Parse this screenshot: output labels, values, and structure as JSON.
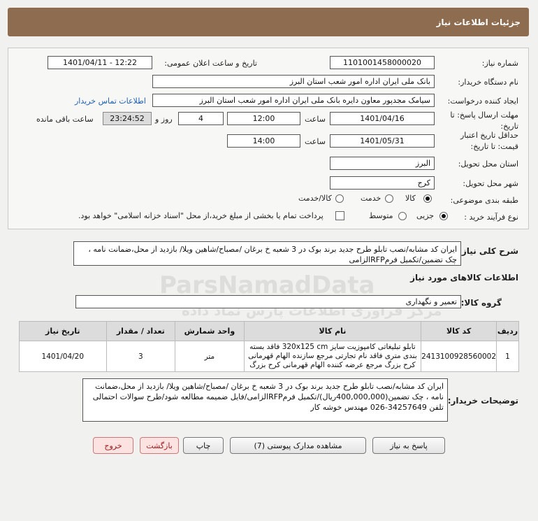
{
  "header": {
    "title": "جزئیات اطلاعات نیاز"
  },
  "fields": {
    "need_number_label": "شماره نیاز:",
    "need_number": "1101001458000020",
    "announce_label": "تاریخ و ساعت اعلان عمومی:",
    "announce_value": "1401/04/11 - 12:22",
    "buyer_org_label": "نام دستگاه خریدار:",
    "buyer_org": "بانک ملی ایران اداره امور شعب استان البرز",
    "creator_label": "ایجاد کننده درخواست:",
    "creator": "سیامک مجدپور معاون دایره  بانک ملی ایران اداره امور شعب استان البرز",
    "contact_link": "اطلاعات تماس خریدار",
    "reply_deadline_label": "مهلت ارسال پاسخ: تا تاریخ:",
    "reply_date": "1401/04/16",
    "time_label": "ساعت",
    "reply_time": "12:00",
    "days_value": "4",
    "days_label": "روز و",
    "remaining_time": "23:24:52",
    "remaining_label": "ساعت باقی مانده",
    "validity_label": "حداقل تاریخ اعتبار قیمت: تا تاریخ:",
    "validity_date": "1401/05/31",
    "validity_time_label": "ساعت",
    "validity_time": "14:00",
    "province_label": "استان محل تحویل:",
    "province": "البرز",
    "city_label": "شهر محل تحویل:",
    "city": "کرج",
    "category_label": "طبقه بندی موضوعی:",
    "category_options": [
      "کالا",
      "خدمت",
      "کالا/خدمت"
    ],
    "process_label": "نوع فرآیند خرید :",
    "process_options": [
      "جزیی",
      "متوسط"
    ],
    "payment_note": "پرداخت تمام یا بخشی از مبلغ خرید،از محل \"اسناد خزانه اسلامی\" خواهد بود."
  },
  "summary": {
    "label": "شرح کلی نیاز:",
    "text": "ایران کد مشابه/نصب تابلو طرح جدید برند بوک در 3 شعبه خ برغان /مصباح/شاهین ویلا/ بازدید از محل،ضمانت نامه ، چک تضمین/تکمیل فرمRFPالزامی"
  },
  "goods": {
    "section_title": "اطلاعات کالاهای مورد نیاز",
    "group_label": "گروه کالا:",
    "group_value": "تعمیر و نگهداری",
    "columns": [
      "ردیف",
      "کد کالا",
      "نام کالا",
      "واحد شمارش",
      "تعداد / مقدار",
      "تاریخ نیاز"
    ],
    "rows": [
      {
        "row": "1",
        "code": "2413100928560002",
        "name": "تابلو تبلیغاتی کامپوزیت سایز 320x125 cm فاقد بسته بندی متری فاقد نام تجارتی مرجع سازنده الهام قهرمانی کرح بزرگ مرجع عرضه کننده الهام قهرمانی کرح بزرگ",
        "unit": "متر",
        "qty": "3",
        "date": "1401/04/20"
      }
    ]
  },
  "buyer_notes": {
    "label": "توضیحات خریدار:",
    "text": "ایران کد مشابه/نصب تابلو طرح جدید برند بوک در 3 شعبه خ برغان /مصباح/شاهین ویلا/ بازدید از محل،ضمانت نامه ، چک تضمین(400,000,000ریال)/تکمیل فرمRFPالزامی/فایل ضمیمه مطالعه شود/طرح سوالات احتمالی تلفن 34257649-026 مهندس خوشه کار"
  },
  "buttons": {
    "reply": "پاسخ به نیاز",
    "attachments": "مشاهده مدارک پیوستی (7)",
    "print": "چاپ",
    "back": "بازگشت",
    "exit": "خروج"
  },
  "watermark": {
    "brand": "ParsNamadData",
    "tagline": "مرکز فراوری اطلاعات پارس نماد داده"
  },
  "colors": {
    "header_bg": "#8d6c4f",
    "link": "#1f5fb5",
    "danger": "#a0191a"
  }
}
